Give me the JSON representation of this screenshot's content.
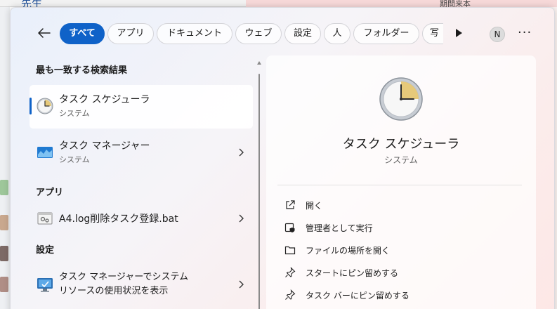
{
  "background": {
    "top_left_text": "先生",
    "top_right_text": "期間来本"
  },
  "filters": {
    "back_label": "back",
    "tabs": [
      {
        "label": "すべて",
        "active": true
      },
      {
        "label": "アプリ",
        "active": false
      },
      {
        "label": "ドキュメント",
        "active": false
      },
      {
        "label": "ウェブ",
        "active": false
      },
      {
        "label": "設定",
        "active": false
      },
      {
        "label": "人",
        "active": false
      },
      {
        "label": "フォルダー",
        "active": false
      },
      {
        "label": "写",
        "active": false
      }
    ],
    "avatar_initial": "N",
    "more_label": "···"
  },
  "results": {
    "best_match_header": "最も一致する検索結果",
    "apps_header": "アプリ",
    "settings_header": "設定",
    "items": [
      {
        "title": "タスク スケジューラ",
        "subtitle": "システム",
        "icon": "clock-icon",
        "selected": true
      },
      {
        "title": "タスク マネージャー",
        "subtitle": "システム",
        "icon": "task-manager-icon",
        "selected": false
      },
      {
        "title": "A4.log削除タスク登録.bat",
        "subtitle": "",
        "icon": "batch-file-icon",
        "selected": false
      },
      {
        "title_line1": "タスク マネージャーでシステム",
        "title_line2": "リソースの使用状況を表示",
        "icon": "monitor-settings-icon",
        "selected": false
      }
    ]
  },
  "detail": {
    "title": "タスク スケジューラ",
    "subtitle": "システム",
    "icon": "clock-icon",
    "actions": [
      {
        "label": "開く",
        "icon": "open-external-icon"
      },
      {
        "label": "管理者として実行",
        "icon": "admin-shield-icon"
      },
      {
        "label": "ファイルの場所を開く",
        "icon": "folder-icon"
      },
      {
        "label": "スタートにピン留めする",
        "icon": "pin-icon"
      },
      {
        "label": "タスク バーにピン留めする",
        "icon": "pin-icon"
      }
    ]
  },
  "colors": {
    "accent": "#0f62c8"
  }
}
